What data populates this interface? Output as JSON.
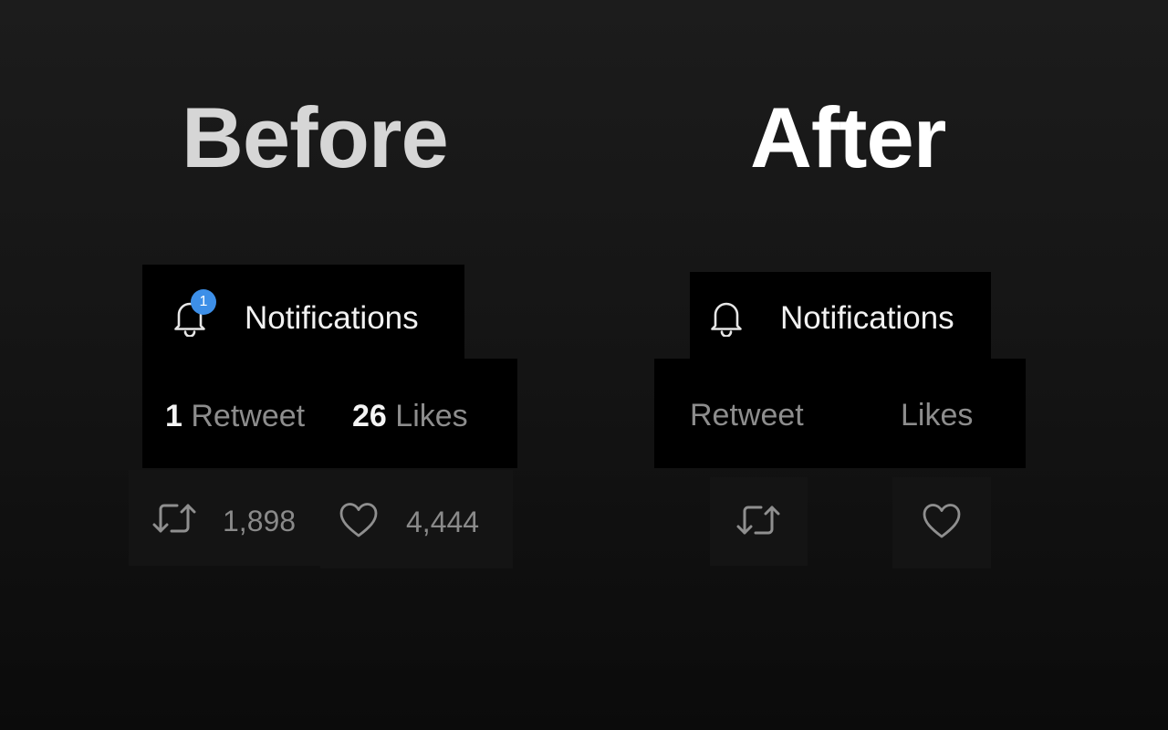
{
  "before": {
    "heading": "Before",
    "notifications": {
      "label": "Notifications",
      "badge_count": "1",
      "icon": "bell-icon"
    },
    "stats": {
      "retweet_count": "1",
      "retweet_label": "Retweet",
      "likes_count": "26",
      "likes_label": "Likes"
    },
    "actions": {
      "retweet_icon": "retweet-icon",
      "retweet_count": "1,898",
      "like_icon": "heart-icon",
      "like_count": "4,444"
    }
  },
  "after": {
    "heading": "After",
    "notifications": {
      "label": "Notifications",
      "icon": "bell-icon"
    },
    "stats": {
      "retweet_label": "Retweet",
      "likes_label": "Likes"
    },
    "actions": {
      "retweet_icon": "retweet-icon",
      "like_icon": "heart-icon"
    }
  },
  "colors": {
    "badge": "#3d8fe8",
    "panel": "#000000",
    "muted_text": "#8d8d8d"
  }
}
